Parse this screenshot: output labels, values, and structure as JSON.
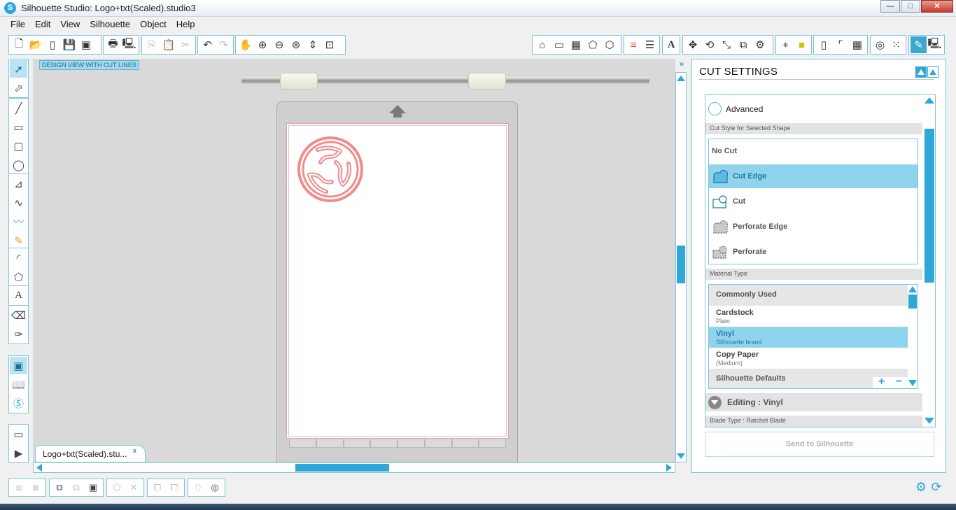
{
  "window": {
    "title": "Silhouette Studio: Logo+txt(Scaled).studio3",
    "app_icon": "S"
  },
  "window_buttons": {
    "minimize": "—",
    "maximize": "□",
    "close": "✕"
  },
  "menu": [
    "File",
    "Edit",
    "View",
    "Silhouette",
    "Object",
    "Help"
  ],
  "canvas": {
    "view_label": "DESIGN VIEW WITH CUT LINES",
    "doc_tab": "Logo+txt(Scaled).stu...",
    "doc_tab_close": "x"
  },
  "right_panel": {
    "title": "CUT SETTINGS",
    "advanced": "Advanced",
    "cut_style_label": "Cut Style for Selected Shape",
    "cut_styles": [
      "No Cut",
      "Cut Edge",
      "Cut",
      "Perforate Edge",
      "Perforate"
    ],
    "selected_cut_style": "Cut Edge",
    "material_label": "Material Type",
    "materials": {
      "group_common": "Commonly Used",
      "items": [
        {
          "name": "Cardstock",
          "sub": "Plain"
        },
        {
          "name": "Vinyl",
          "sub": "Silhouette brand"
        },
        {
          "name": "Copy Paper",
          "sub": "(Medium)"
        }
      ],
      "group_defaults": "Silhouette Defaults",
      "add": "+",
      "remove": "−"
    },
    "editing": "Editing : Vinyl",
    "blade_type": "Blade Type : Ratchet Blade",
    "send_button": "Send to Silhouette"
  },
  "colors": {
    "accent": "#2ea7d9",
    "selected_row": "#8fd3ec",
    "cut_line": "#f08c8c"
  }
}
